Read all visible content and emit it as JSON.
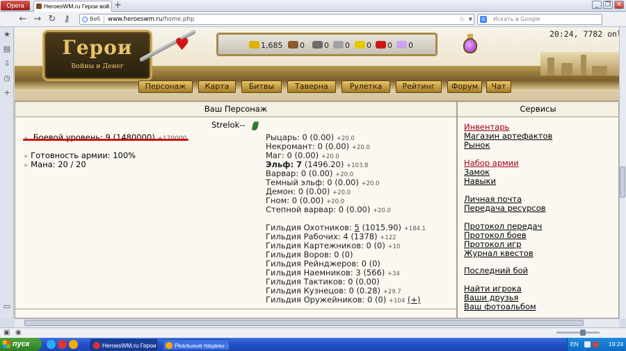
{
  "browser": {
    "opera_label": "Opera",
    "tab_title": "HeroesWM.ru Герои вой...",
    "new_tab": "+",
    "badge": "Веб",
    "url_host": "www.heroeswm.ru",
    "url_path": "/home.php",
    "search_placeholder": "Искать в Google",
    "win_minimize": "_",
    "win_restore": "❐",
    "win_close": "✕"
  },
  "header": {
    "logo_title": "Герои",
    "logo_subtitle": "Войны и Денег",
    "time_status": "20:24, 7782 onlin",
    "resources": [
      {
        "name": "gold",
        "value": "1,685",
        "color": "#e0b000"
      },
      {
        "name": "wood",
        "value": "0",
        "color": "#8a5a2b"
      },
      {
        "name": "ore",
        "value": "0",
        "color": "#6c6c6c"
      },
      {
        "name": "mercury",
        "value": "0",
        "color": "#a0a0a8"
      },
      {
        "name": "sulfur",
        "value": "0",
        "color": "#e8c800"
      },
      {
        "name": "crystals",
        "value": "0",
        "color": "#d01818"
      },
      {
        "name": "gems",
        "value": "0",
        "color": "#d0a0f0"
      }
    ],
    "menu": [
      "Персонаж",
      "Карта",
      "Битвы",
      "Таверна",
      "Рулетка",
      "Рейтинг",
      "Форум",
      "Чат"
    ]
  },
  "character": {
    "section_title": "Ваш Персонаж",
    "hero_name": "Strelok--",
    "combat_level_label": "Боевой уровень: 9",
    "combat_level_exp": "(1480000)",
    "combat_level_bonus": "+170000",
    "army_ready": "Готовность армии: 100%",
    "mana": "Мана: 20 / 20",
    "factions": [
      {
        "label": "Рыцарь: 0",
        "value": "(0.00)",
        "bonus": "+20.0"
      },
      {
        "label": "Некромант: 0",
        "value": "(0.00)",
        "bonus": "+20.0"
      },
      {
        "label": "Маг: 0",
        "value": "(0.00)",
        "bonus": "+20.0"
      },
      {
        "label": "Эльф: 7",
        "value": "(1496.20)",
        "bonus": "+103.8",
        "bold": true
      },
      {
        "label": "Варвар: 0",
        "value": "(0.00)",
        "bonus": "+20.0"
      },
      {
        "label": "Темный эльф: 0",
        "value": "(0.00)",
        "bonus": "+20.0"
      },
      {
        "label": "Демон: 0",
        "value": "(0.00)",
        "bonus": "+20.0"
      },
      {
        "label": "Гном: 0",
        "value": "(0.00)",
        "bonus": "+20.0"
      },
      {
        "label": "Степной варвар: 0",
        "value": "(0.00)",
        "bonus": "+20.0"
      }
    ],
    "guilds": [
      {
        "label": "Гильдия Охотников:",
        "level": "5",
        "value": "(1015.90)",
        "bonus": "+184.1",
        "level_link": true
      },
      {
        "label": "Гильдия Рабочих: 4",
        "value": "(1378)",
        "bonus": "+122"
      },
      {
        "label": "Гильдия Картежников: 0",
        "value": "(0)",
        "bonus": "+10"
      },
      {
        "label": "Гильдия Воров: 0",
        "value": "(0)",
        "bonus": ""
      },
      {
        "label": "Гильдия Рейнджеров: 0",
        "value": "(0)",
        "bonus": ""
      },
      {
        "label": "Гильдия Наемников: 3",
        "value": "(566)",
        "bonus": "+34"
      },
      {
        "label": "Гильдия Тактиков: 0",
        "value": "(0.00)",
        "bonus": ""
      },
      {
        "label": "Гильдия Кузнецов: 0",
        "value": "(0.28)",
        "bonus": "+29.7"
      },
      {
        "label": "Гильдия Оружейников: 0",
        "value": "(0)",
        "bonus": "+104",
        "extra": "(+)"
      }
    ]
  },
  "services": {
    "section_title": "Сервисы",
    "links": [
      {
        "label": "Инвентарь",
        "red": true
      },
      {
        "label": "Магазин артефактов"
      },
      {
        "label": "Рынок"
      },
      {
        "label": "Набор армии",
        "red": true
      },
      {
        "label": "Замок"
      },
      {
        "label": "Навыки"
      },
      {
        "label": "Личная почта"
      },
      {
        "label": "Передача ресурсов"
      },
      {
        "label": "Протокол передач"
      },
      {
        "label": "Протокол боев"
      },
      {
        "label": "Протокол игр"
      },
      {
        "label": "Журнал квестов"
      },
      {
        "label": "Последний бой"
      },
      {
        "label": "Найти игрока"
      },
      {
        "label": "Ваши друзья"
      },
      {
        "label": "Ваш фотоальбом"
      }
    ]
  },
  "taskbar": {
    "start": "пуск",
    "tasks": [
      "HeroesWM.ru Герои ...",
      "Реальные пацаны - ..."
    ],
    "lang": "EN",
    "clock": "19:24"
  }
}
